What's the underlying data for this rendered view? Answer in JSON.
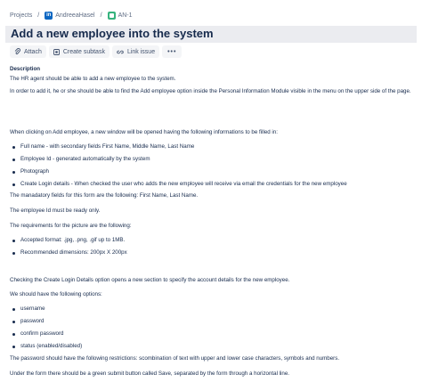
{
  "breadcrumb": {
    "projects": "Projects",
    "project_name": "AndreeaHasel",
    "project_icon_letter": "in",
    "issue_key": "AN-1"
  },
  "issue": {
    "title": "Add a new employee into the system"
  },
  "toolbar": {
    "attach": "Attach",
    "create_subtask": "Create subtask",
    "link_issue": "Link issue",
    "more": "•••"
  },
  "description": {
    "label": "Description",
    "p1": "The HR agent should be able to add a new employee to the system.",
    "p2": "In order to add it, he or she should be able to find the Add employee option inside the Personal Information Module visible in the menu on the upper side of the page.",
    "p3": "When clicking on Add employee, a new window will be opened having the following informations to be filled in:",
    "list1": [
      "Full name - with secondary fields First Name, Middle Name, Last Name",
      "Employee Id - generated automatically by the system",
      "Photograph",
      "Create Login details - When checked the user who adds the new employee will receive via email the credentials for the new employee"
    ],
    "p4": "The manadatory fields for this form are the following: First Name, Last Name.",
    "p5": "The employee Id must be ready only.",
    "p6": "The requirements for the picture are the following:",
    "list2": [
      "Accepted format: .jpg, .png, .gif up to 1MB.",
      "Recommended dimensions: 200px X 200px"
    ],
    "p7": "Checking the Create Login Details option opens a new section to specify the account details for the new employee.",
    "p8": "We should have the following options:",
    "list3": [
      "username",
      "password",
      "confirm password",
      "status (enabled/disabled)"
    ],
    "p9": "The password should have the following restrictions: scombination of text with upper and lower case characters, symbols and numbers.",
    "p10": "Under the form there should be a green submit button called Save, separated by the form through a horizontal line."
  }
}
